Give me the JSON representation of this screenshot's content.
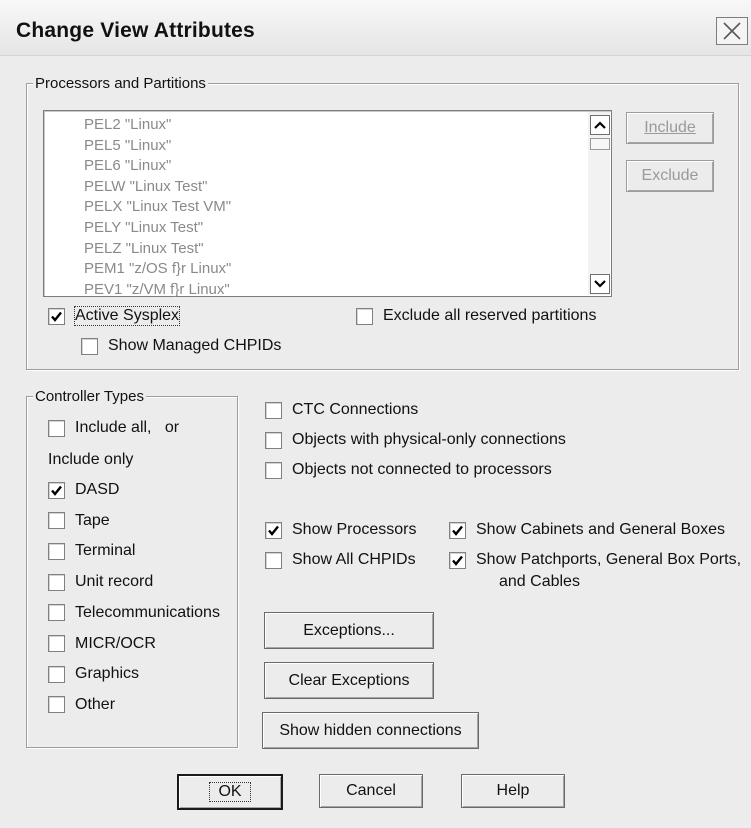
{
  "window": {
    "title": "Change View Attributes"
  },
  "processors": {
    "legend": "Processors and Partitions",
    "list": [
      "PEL2 \"Linux\"",
      "PEL5 \"Linux\"",
      "PEL6 \"Linux\"",
      "PELW \"Linux Test\"",
      "PELX \"Linux Test VM\"",
      "PELY \"Linux Test\"",
      "PELZ \"Linux Test\"",
      "PEM1 \"z/OS f}r Linux\"",
      "PEV1 \"z/VM f}r Linux\""
    ],
    "include_label": "Include",
    "exclude_label": "Exclude",
    "active_sysplex": {
      "label": "Active Sysplex",
      "checked": true
    },
    "exclude_reserved": {
      "label": "Exclude all reserved partitions",
      "checked": false
    },
    "show_managed": {
      "label": "Show Managed CHPIDs",
      "checked": false
    }
  },
  "controller": {
    "legend": "Controller Types",
    "include_all": {
      "label": "Include all,   or",
      "checked": false
    },
    "include_only_label": "Include only",
    "types": [
      {
        "label": "DASD",
        "checked": true
      },
      {
        "label": "Tape",
        "checked": false
      },
      {
        "label": "Terminal",
        "checked": false
      },
      {
        "label": "Unit record",
        "checked": false
      },
      {
        "label": "Telecommunications",
        "checked": false
      },
      {
        "label": "MICR/OCR",
        "checked": false
      },
      {
        "label": "Graphics",
        "checked": false
      },
      {
        "label": "Other",
        "checked": false
      }
    ]
  },
  "options": {
    "ctc": {
      "label": "CTC Connections",
      "checked": false
    },
    "physical_only": {
      "label": "Objects with physical-only connections",
      "checked": false
    },
    "not_connected": {
      "label": "Objects not connected to processors",
      "checked": false
    },
    "show_processors": {
      "label": "Show Processors",
      "checked": true
    },
    "show_cabinets": {
      "label": "Show Cabinets and General Boxes",
      "checked": true
    },
    "show_all_chpids": {
      "label": "Show All CHPIDs",
      "checked": false
    },
    "show_patchports": {
      "label": "Show Patchports, General Box Ports,",
      "label2": "and Cables",
      "checked": true
    }
  },
  "buttons": {
    "exceptions": "Exceptions...",
    "clear_exceptions": "Clear Exceptions",
    "show_hidden": "Show hidden connections",
    "ok": "OK",
    "cancel": "Cancel",
    "help": "Help"
  }
}
